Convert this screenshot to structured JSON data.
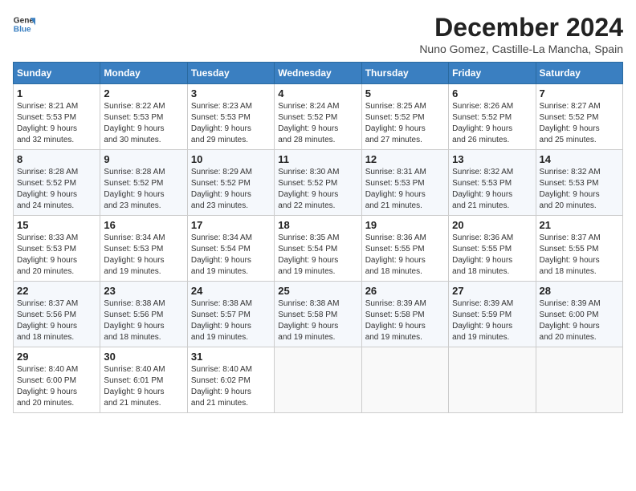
{
  "logo": {
    "general": "General",
    "blue": "Blue"
  },
  "header": {
    "title": "December 2024",
    "subtitle": "Nuno Gomez, Castille-La Mancha, Spain"
  },
  "weekdays": [
    "Sunday",
    "Monday",
    "Tuesday",
    "Wednesday",
    "Thursday",
    "Friday",
    "Saturday"
  ],
  "weeks": [
    [
      {
        "day": "1",
        "info": "Sunrise: 8:21 AM\nSunset: 5:53 PM\nDaylight: 9 hours\nand 32 minutes."
      },
      {
        "day": "2",
        "info": "Sunrise: 8:22 AM\nSunset: 5:53 PM\nDaylight: 9 hours\nand 30 minutes."
      },
      {
        "day": "3",
        "info": "Sunrise: 8:23 AM\nSunset: 5:53 PM\nDaylight: 9 hours\nand 29 minutes."
      },
      {
        "day": "4",
        "info": "Sunrise: 8:24 AM\nSunset: 5:52 PM\nDaylight: 9 hours\nand 28 minutes."
      },
      {
        "day": "5",
        "info": "Sunrise: 8:25 AM\nSunset: 5:52 PM\nDaylight: 9 hours\nand 27 minutes."
      },
      {
        "day": "6",
        "info": "Sunrise: 8:26 AM\nSunset: 5:52 PM\nDaylight: 9 hours\nand 26 minutes."
      },
      {
        "day": "7",
        "info": "Sunrise: 8:27 AM\nSunset: 5:52 PM\nDaylight: 9 hours\nand 25 minutes."
      }
    ],
    [
      {
        "day": "8",
        "info": "Sunrise: 8:28 AM\nSunset: 5:52 PM\nDaylight: 9 hours\nand 24 minutes."
      },
      {
        "day": "9",
        "info": "Sunrise: 8:28 AM\nSunset: 5:52 PM\nDaylight: 9 hours\nand 23 minutes."
      },
      {
        "day": "10",
        "info": "Sunrise: 8:29 AM\nSunset: 5:52 PM\nDaylight: 9 hours\nand 23 minutes."
      },
      {
        "day": "11",
        "info": "Sunrise: 8:30 AM\nSunset: 5:52 PM\nDaylight: 9 hours\nand 22 minutes."
      },
      {
        "day": "12",
        "info": "Sunrise: 8:31 AM\nSunset: 5:53 PM\nDaylight: 9 hours\nand 21 minutes."
      },
      {
        "day": "13",
        "info": "Sunrise: 8:32 AM\nSunset: 5:53 PM\nDaylight: 9 hours\nand 21 minutes."
      },
      {
        "day": "14",
        "info": "Sunrise: 8:32 AM\nSunset: 5:53 PM\nDaylight: 9 hours\nand 20 minutes."
      }
    ],
    [
      {
        "day": "15",
        "info": "Sunrise: 8:33 AM\nSunset: 5:53 PM\nDaylight: 9 hours\nand 20 minutes."
      },
      {
        "day": "16",
        "info": "Sunrise: 8:34 AM\nSunset: 5:53 PM\nDaylight: 9 hours\nand 19 minutes."
      },
      {
        "day": "17",
        "info": "Sunrise: 8:34 AM\nSunset: 5:54 PM\nDaylight: 9 hours\nand 19 minutes."
      },
      {
        "day": "18",
        "info": "Sunrise: 8:35 AM\nSunset: 5:54 PM\nDaylight: 9 hours\nand 19 minutes."
      },
      {
        "day": "19",
        "info": "Sunrise: 8:36 AM\nSunset: 5:55 PM\nDaylight: 9 hours\nand 18 minutes."
      },
      {
        "day": "20",
        "info": "Sunrise: 8:36 AM\nSunset: 5:55 PM\nDaylight: 9 hours\nand 18 minutes."
      },
      {
        "day": "21",
        "info": "Sunrise: 8:37 AM\nSunset: 5:55 PM\nDaylight: 9 hours\nand 18 minutes."
      }
    ],
    [
      {
        "day": "22",
        "info": "Sunrise: 8:37 AM\nSunset: 5:56 PM\nDaylight: 9 hours\nand 18 minutes."
      },
      {
        "day": "23",
        "info": "Sunrise: 8:38 AM\nSunset: 5:56 PM\nDaylight: 9 hours\nand 18 minutes."
      },
      {
        "day": "24",
        "info": "Sunrise: 8:38 AM\nSunset: 5:57 PM\nDaylight: 9 hours\nand 19 minutes."
      },
      {
        "day": "25",
        "info": "Sunrise: 8:38 AM\nSunset: 5:58 PM\nDaylight: 9 hours\nand 19 minutes."
      },
      {
        "day": "26",
        "info": "Sunrise: 8:39 AM\nSunset: 5:58 PM\nDaylight: 9 hours\nand 19 minutes."
      },
      {
        "day": "27",
        "info": "Sunrise: 8:39 AM\nSunset: 5:59 PM\nDaylight: 9 hours\nand 19 minutes."
      },
      {
        "day": "28",
        "info": "Sunrise: 8:39 AM\nSunset: 6:00 PM\nDaylight: 9 hours\nand 20 minutes."
      }
    ],
    [
      {
        "day": "29",
        "info": "Sunrise: 8:40 AM\nSunset: 6:00 PM\nDaylight: 9 hours\nand 20 minutes."
      },
      {
        "day": "30",
        "info": "Sunrise: 8:40 AM\nSunset: 6:01 PM\nDaylight: 9 hours\nand 21 minutes."
      },
      {
        "day": "31",
        "info": "Sunrise: 8:40 AM\nSunset: 6:02 PM\nDaylight: 9 hours\nand 21 minutes."
      },
      null,
      null,
      null,
      null
    ]
  ]
}
